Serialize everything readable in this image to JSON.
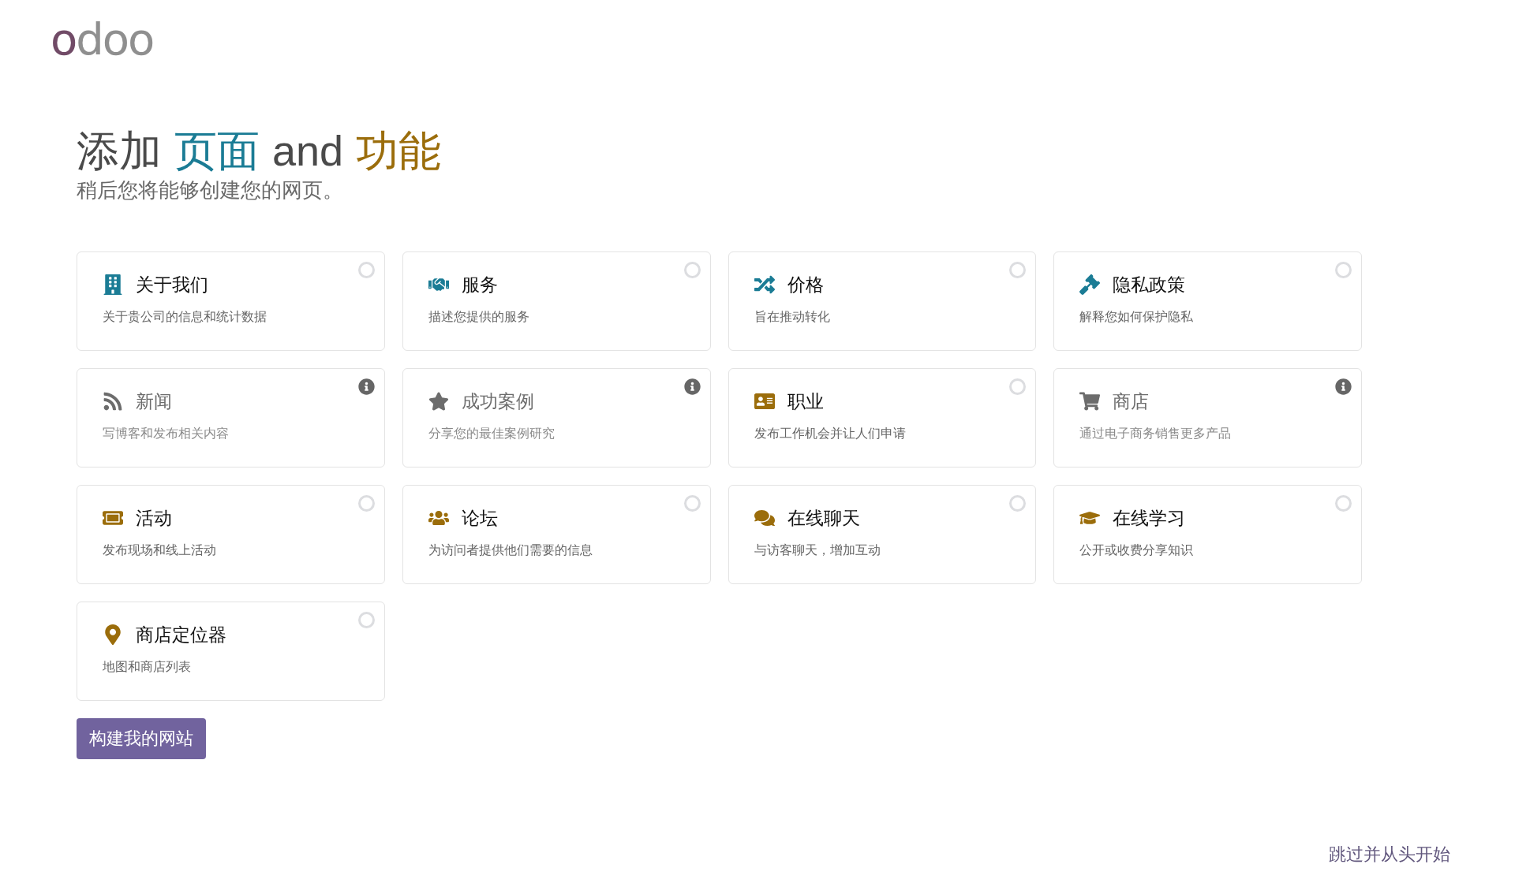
{
  "logo": "odoo",
  "heading": [
    {
      "text": "添加",
      "kind": "plain"
    },
    {
      "text": "页面",
      "kind": "page"
    },
    {
      "text": "and",
      "kind": "plain"
    },
    {
      "text": "功能",
      "kind": "feature"
    }
  ],
  "subtitle": "稍后您将能够创建您的网页。",
  "cards": [
    {
      "title": "关于我们",
      "description": "关于贵公司的信息和统计数据",
      "kind": "page",
      "disabled": false,
      "checked": false
    },
    {
      "title": "服务",
      "description": "描述您提供的服务",
      "kind": "page",
      "disabled": false,
      "checked": false
    },
    {
      "title": "价格",
      "description": "旨在推动转化",
      "kind": "page",
      "disabled": false,
      "checked": false
    },
    {
      "title": "隐私政策",
      "description": "解释您如何保护隐私",
      "kind": "page",
      "disabled": false,
      "checked": false
    },
    {
      "title": "新闻",
      "description": "写博客和发布相关内容",
      "disabled": true,
      "checked": false
    },
    {
      "title": "成功案例",
      "description": "分享您的最佳案例研究",
      "disabled": true,
      "checked": false
    },
    {
      "title": "职业",
      "description": "发布工作机会并让人们申请",
      "kind": "feature",
      "disabled": false,
      "checked": false
    },
    {
      "title": "商店",
      "description": "通过电子商务销售更多产品",
      "disabled": true,
      "checked": false
    },
    {
      "title": "活动",
      "description": "发布现场和线上活动",
      "kind": "feature",
      "disabled": false,
      "checked": false
    },
    {
      "title": "论坛",
      "description": "为访问者提供他们需要的信息",
      "kind": "feature",
      "disabled": false,
      "checked": false
    },
    {
      "title": "在线聊天",
      "description": "与访客聊天，增加互动",
      "kind": "feature",
      "disabled": false,
      "checked": false
    },
    {
      "title": "在线学习",
      "description": "公开或收费分享知识",
      "kind": "feature",
      "disabled": false,
      "checked": false
    },
    {
      "title": "商店定位器",
      "description": "地图和商店列表",
      "kind": "feature",
      "disabled": false,
      "checked": false
    }
  ],
  "build_button": "构建我的网站",
  "skip_link": "跳过并从头开始"
}
